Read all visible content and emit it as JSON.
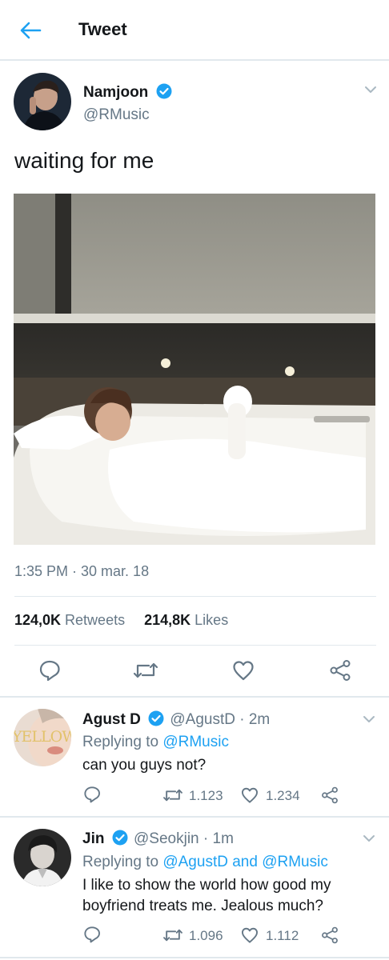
{
  "header": {
    "title": "Tweet"
  },
  "tweet": {
    "name": "Namjoon",
    "handle": "@RMusic",
    "text": "waiting for me",
    "timestamp": "1:35 PM · 30 mar. 18",
    "retweets_count": "124,0K",
    "retweets_label": " Retweets",
    "likes_count": "214,8K",
    "likes_label": " Likes"
  },
  "replies": [
    {
      "name": "Agust D",
      "handle_time": "@AgustD · 2m",
      "avatar_text": "YELLOW",
      "replying_prefix": "Replying to ",
      "replying_to": "@RMusic",
      "text": "can you guys not?",
      "retweets": "1.123",
      "likes": "1.234"
    },
    {
      "name": "Jin",
      "handle_time": "@Seokjin · 1m",
      "replying_prefix": "Replying to ",
      "replying_to": "@AgustD and @RMusic",
      "text_line1": "I like to show the world how good my",
      "text_line2": "boyfriend treats me. Jealous much?",
      "retweets": "1.096",
      "likes": "1.112"
    }
  ],
  "colors": {
    "accent": "#1da1f2",
    "secondary": "#657786",
    "border": "#e1e8ed"
  },
  "icons": [
    "back-arrow-icon",
    "verified-badge-icon",
    "chevron-down-icon",
    "reply-icon",
    "retweet-icon",
    "like-icon",
    "share-icon"
  ]
}
